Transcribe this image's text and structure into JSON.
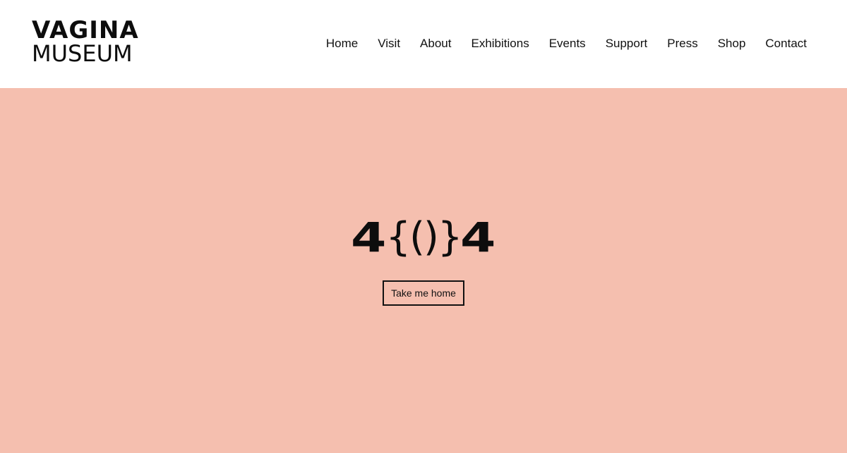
{
  "brand": {
    "line1": "VAGINA",
    "line2": "MUSEUM"
  },
  "nav": {
    "items": [
      "Home",
      "Visit",
      "About",
      "Exhibitions",
      "Events",
      "Support",
      "Press",
      "Shop",
      "Contact"
    ]
  },
  "error": {
    "left_digit": "4",
    "middle": "{()}",
    "right_digit": "4"
  },
  "cta": {
    "label": "Take me home"
  },
  "colors": {
    "hero_background": "#f5bfaf",
    "header_background": "#ffffff",
    "text": "#111111"
  }
}
